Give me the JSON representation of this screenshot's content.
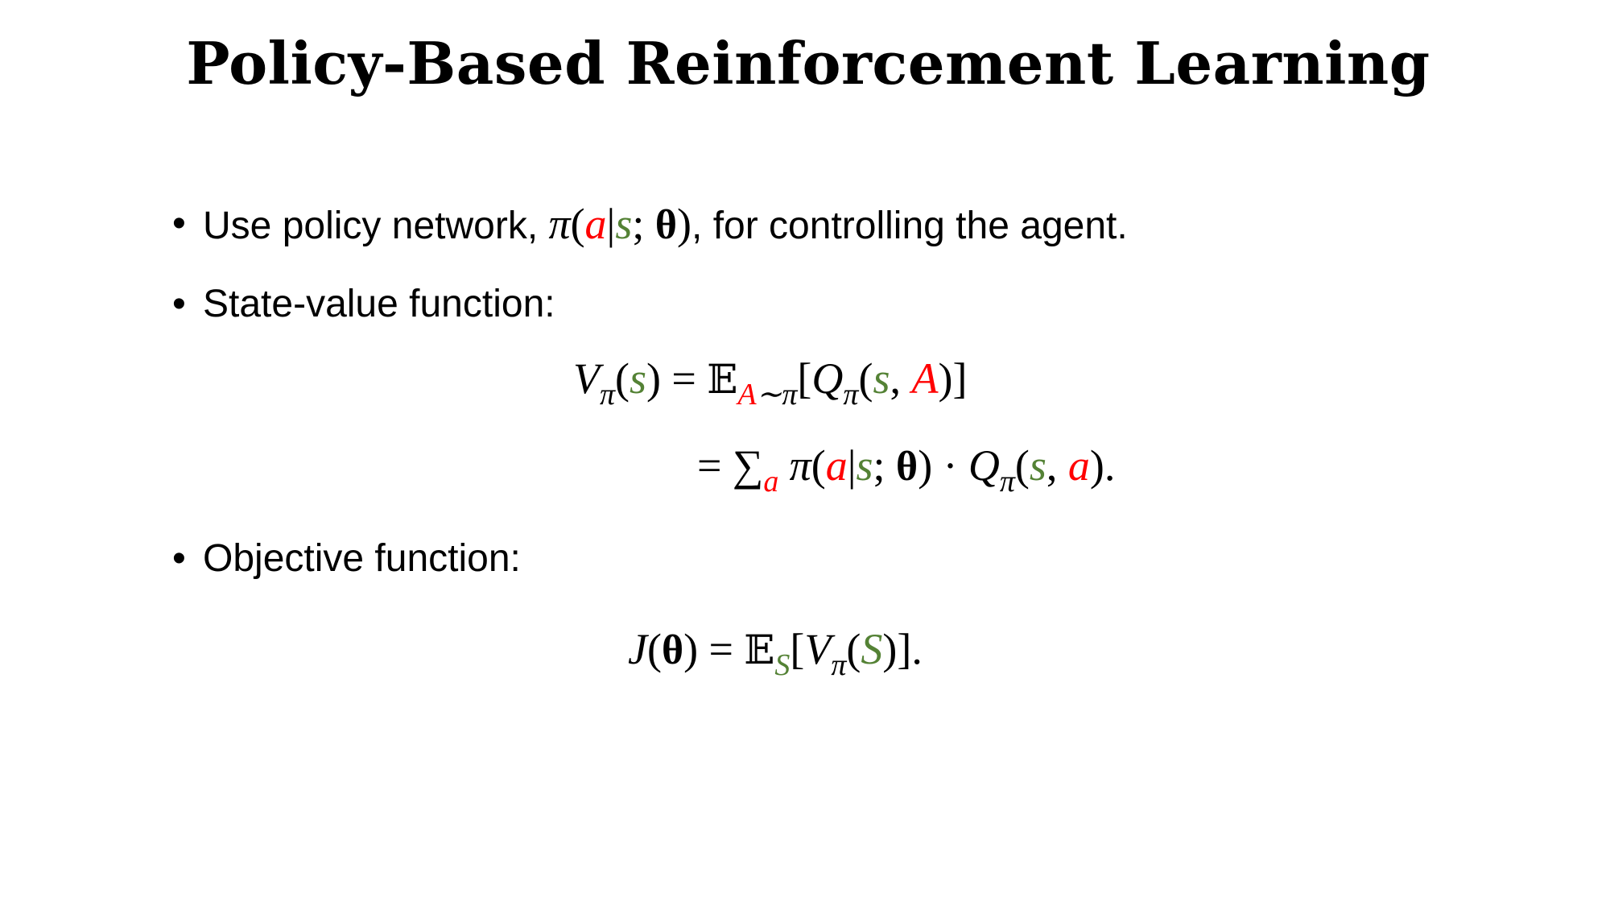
{
  "title": "Policy-Based Reinforcement Learning",
  "colors": {
    "action": "#ff0000",
    "state": "#548235"
  },
  "bullets": [
    {
      "pre": "Use policy network, ",
      "post": ", for controlling the agent."
    },
    {
      "text": "State-value function:"
    },
    {
      "text": "Objective function:"
    }
  ],
  "bullet_glyph": "•",
  "math": {
    "pi": "π",
    "a": "a",
    "s": "s",
    "A": "A",
    "S": "S",
    "theta": "θ",
    "V": "V",
    "Q": "Q",
    "J": "J",
    "E": "𝔼",
    "sum": "∑",
    "tilde": "∼",
    "eq": "=",
    "dot": "·",
    "lp": "(",
    "rp": ")",
    "lb": "[",
    "rb": "]",
    "bar": "|",
    "semi": "; ",
    "comma": ", ",
    "period": "."
  }
}
